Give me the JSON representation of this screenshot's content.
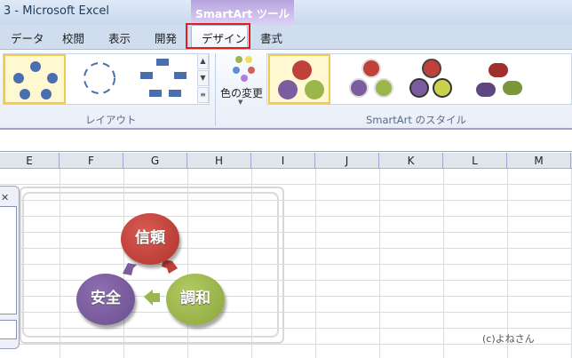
{
  "window": {
    "title": "3 - Microsoft Excel",
    "context_tab_group": "SmartArt ツール"
  },
  "tabs": [
    "データ",
    "校閲",
    "表示",
    "開発",
    "デザイン",
    "書式"
  ],
  "active_tab": "デザイン",
  "ribbon": {
    "layout_group_label": "レイアウト",
    "change_colors_label": "色の変更",
    "styles_group_label": "SmartArt のスタイル"
  },
  "columns": [
    "E",
    "F",
    "G",
    "H",
    "I",
    "J",
    "K",
    "L",
    "M"
  ],
  "smartart": {
    "nodes": [
      {
        "label": "信頼",
        "color": "#c0403a"
      },
      {
        "label": "調和",
        "color": "#9bb64c"
      },
      {
        "label": "安全",
        "color": "#7b5c9e"
      }
    ]
  },
  "watermark": "(c)よねさん"
}
